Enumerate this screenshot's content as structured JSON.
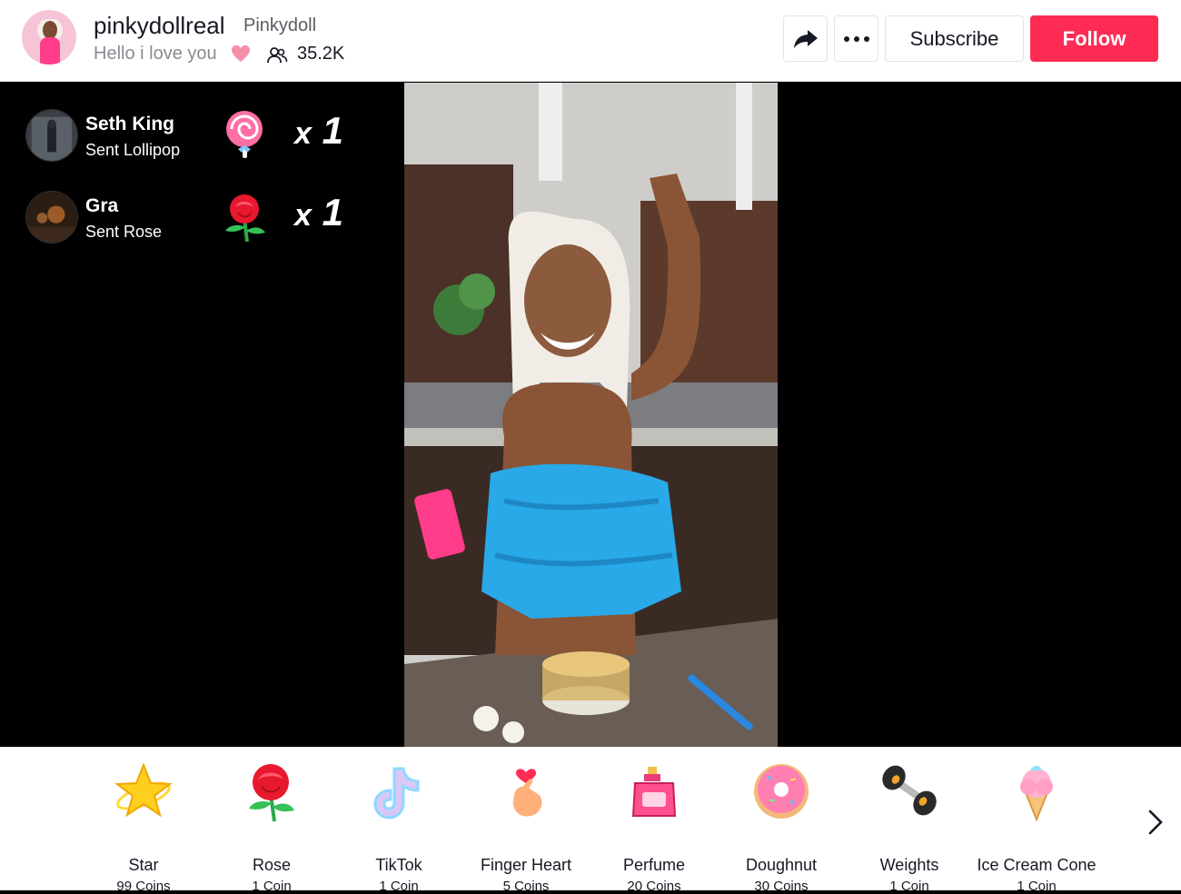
{
  "header": {
    "username": "pinkydollreal",
    "nickname": "Pinkydoll",
    "bio": "Hello i love you",
    "heart_emoji": "❤",
    "viewer_count": "35.2K",
    "subscribe_label": "Subscribe",
    "follow_label": "Follow",
    "follow_color": "#fe2c55"
  },
  "gift_feed": [
    {
      "name": "Seth King",
      "action": "Sent Lollipop",
      "gift_icon": "lollipop-icon",
      "multiplier": "x",
      "count": "1"
    },
    {
      "name": "Gra",
      "action": "Sent Rose",
      "gift_icon": "rose-icon",
      "multiplier": "x",
      "count": "1"
    }
  ],
  "gifts": [
    {
      "name": "Star",
      "price": "99 Coins",
      "icon": "star-icon"
    },
    {
      "name": "Rose",
      "price": "1 Coin",
      "icon": "rose-icon"
    },
    {
      "name": "TikTok",
      "price": "1 Coin",
      "icon": "tiktok-icon"
    },
    {
      "name": "Finger Heart",
      "price": "5 Coins",
      "icon": "finger-heart-icon"
    },
    {
      "name": "Perfume",
      "price": "20 Coins",
      "icon": "perfume-icon"
    },
    {
      "name": "Doughnut",
      "price": "30 Coins",
      "icon": "doughnut-icon"
    },
    {
      "name": "Weights",
      "price": "1 Coin",
      "icon": "weights-icon"
    },
    {
      "name": "Ice Cream Cone",
      "price": "1 Coin",
      "icon": "ice-cream-icon"
    }
  ]
}
